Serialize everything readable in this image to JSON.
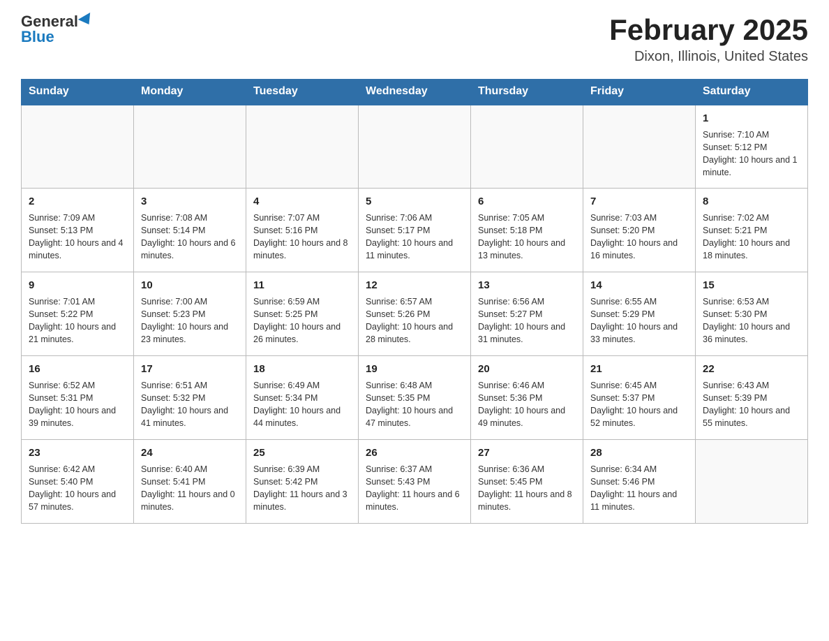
{
  "header": {
    "logo_general": "General",
    "logo_blue": "Blue",
    "title": "February 2025",
    "subtitle": "Dixon, Illinois, United States"
  },
  "days_of_week": [
    "Sunday",
    "Monday",
    "Tuesday",
    "Wednesday",
    "Thursday",
    "Friday",
    "Saturday"
  ],
  "weeks": [
    [
      {
        "day": "",
        "sunrise": "",
        "sunset": "",
        "daylight": ""
      },
      {
        "day": "",
        "sunrise": "",
        "sunset": "",
        "daylight": ""
      },
      {
        "day": "",
        "sunrise": "",
        "sunset": "",
        "daylight": ""
      },
      {
        "day": "",
        "sunrise": "",
        "sunset": "",
        "daylight": ""
      },
      {
        "day": "",
        "sunrise": "",
        "sunset": "",
        "daylight": ""
      },
      {
        "day": "",
        "sunrise": "",
        "sunset": "",
        "daylight": ""
      },
      {
        "day": "1",
        "sunrise": "Sunrise: 7:10 AM",
        "sunset": "Sunset: 5:12 PM",
        "daylight": "Daylight: 10 hours and 1 minute."
      }
    ],
    [
      {
        "day": "2",
        "sunrise": "Sunrise: 7:09 AM",
        "sunset": "Sunset: 5:13 PM",
        "daylight": "Daylight: 10 hours and 4 minutes."
      },
      {
        "day": "3",
        "sunrise": "Sunrise: 7:08 AM",
        "sunset": "Sunset: 5:14 PM",
        "daylight": "Daylight: 10 hours and 6 minutes."
      },
      {
        "day": "4",
        "sunrise": "Sunrise: 7:07 AM",
        "sunset": "Sunset: 5:16 PM",
        "daylight": "Daylight: 10 hours and 8 minutes."
      },
      {
        "day": "5",
        "sunrise": "Sunrise: 7:06 AM",
        "sunset": "Sunset: 5:17 PM",
        "daylight": "Daylight: 10 hours and 11 minutes."
      },
      {
        "day": "6",
        "sunrise": "Sunrise: 7:05 AM",
        "sunset": "Sunset: 5:18 PM",
        "daylight": "Daylight: 10 hours and 13 minutes."
      },
      {
        "day": "7",
        "sunrise": "Sunrise: 7:03 AM",
        "sunset": "Sunset: 5:20 PM",
        "daylight": "Daylight: 10 hours and 16 minutes."
      },
      {
        "day": "8",
        "sunrise": "Sunrise: 7:02 AM",
        "sunset": "Sunset: 5:21 PM",
        "daylight": "Daylight: 10 hours and 18 minutes."
      }
    ],
    [
      {
        "day": "9",
        "sunrise": "Sunrise: 7:01 AM",
        "sunset": "Sunset: 5:22 PM",
        "daylight": "Daylight: 10 hours and 21 minutes."
      },
      {
        "day": "10",
        "sunrise": "Sunrise: 7:00 AM",
        "sunset": "Sunset: 5:23 PM",
        "daylight": "Daylight: 10 hours and 23 minutes."
      },
      {
        "day": "11",
        "sunrise": "Sunrise: 6:59 AM",
        "sunset": "Sunset: 5:25 PM",
        "daylight": "Daylight: 10 hours and 26 minutes."
      },
      {
        "day": "12",
        "sunrise": "Sunrise: 6:57 AM",
        "sunset": "Sunset: 5:26 PM",
        "daylight": "Daylight: 10 hours and 28 minutes."
      },
      {
        "day": "13",
        "sunrise": "Sunrise: 6:56 AM",
        "sunset": "Sunset: 5:27 PM",
        "daylight": "Daylight: 10 hours and 31 minutes."
      },
      {
        "day": "14",
        "sunrise": "Sunrise: 6:55 AM",
        "sunset": "Sunset: 5:29 PM",
        "daylight": "Daylight: 10 hours and 33 minutes."
      },
      {
        "day": "15",
        "sunrise": "Sunrise: 6:53 AM",
        "sunset": "Sunset: 5:30 PM",
        "daylight": "Daylight: 10 hours and 36 minutes."
      }
    ],
    [
      {
        "day": "16",
        "sunrise": "Sunrise: 6:52 AM",
        "sunset": "Sunset: 5:31 PM",
        "daylight": "Daylight: 10 hours and 39 minutes."
      },
      {
        "day": "17",
        "sunrise": "Sunrise: 6:51 AM",
        "sunset": "Sunset: 5:32 PM",
        "daylight": "Daylight: 10 hours and 41 minutes."
      },
      {
        "day": "18",
        "sunrise": "Sunrise: 6:49 AM",
        "sunset": "Sunset: 5:34 PM",
        "daylight": "Daylight: 10 hours and 44 minutes."
      },
      {
        "day": "19",
        "sunrise": "Sunrise: 6:48 AM",
        "sunset": "Sunset: 5:35 PM",
        "daylight": "Daylight: 10 hours and 47 minutes."
      },
      {
        "day": "20",
        "sunrise": "Sunrise: 6:46 AM",
        "sunset": "Sunset: 5:36 PM",
        "daylight": "Daylight: 10 hours and 49 minutes."
      },
      {
        "day": "21",
        "sunrise": "Sunrise: 6:45 AM",
        "sunset": "Sunset: 5:37 PM",
        "daylight": "Daylight: 10 hours and 52 minutes."
      },
      {
        "day": "22",
        "sunrise": "Sunrise: 6:43 AM",
        "sunset": "Sunset: 5:39 PM",
        "daylight": "Daylight: 10 hours and 55 minutes."
      }
    ],
    [
      {
        "day": "23",
        "sunrise": "Sunrise: 6:42 AM",
        "sunset": "Sunset: 5:40 PM",
        "daylight": "Daylight: 10 hours and 57 minutes."
      },
      {
        "day": "24",
        "sunrise": "Sunrise: 6:40 AM",
        "sunset": "Sunset: 5:41 PM",
        "daylight": "Daylight: 11 hours and 0 minutes."
      },
      {
        "day": "25",
        "sunrise": "Sunrise: 6:39 AM",
        "sunset": "Sunset: 5:42 PM",
        "daylight": "Daylight: 11 hours and 3 minutes."
      },
      {
        "day": "26",
        "sunrise": "Sunrise: 6:37 AM",
        "sunset": "Sunset: 5:43 PM",
        "daylight": "Daylight: 11 hours and 6 minutes."
      },
      {
        "day": "27",
        "sunrise": "Sunrise: 6:36 AM",
        "sunset": "Sunset: 5:45 PM",
        "daylight": "Daylight: 11 hours and 8 minutes."
      },
      {
        "day": "28",
        "sunrise": "Sunrise: 6:34 AM",
        "sunset": "Sunset: 5:46 PM",
        "daylight": "Daylight: 11 hours and 11 minutes."
      },
      {
        "day": "",
        "sunrise": "",
        "sunset": "",
        "daylight": ""
      }
    ]
  ]
}
